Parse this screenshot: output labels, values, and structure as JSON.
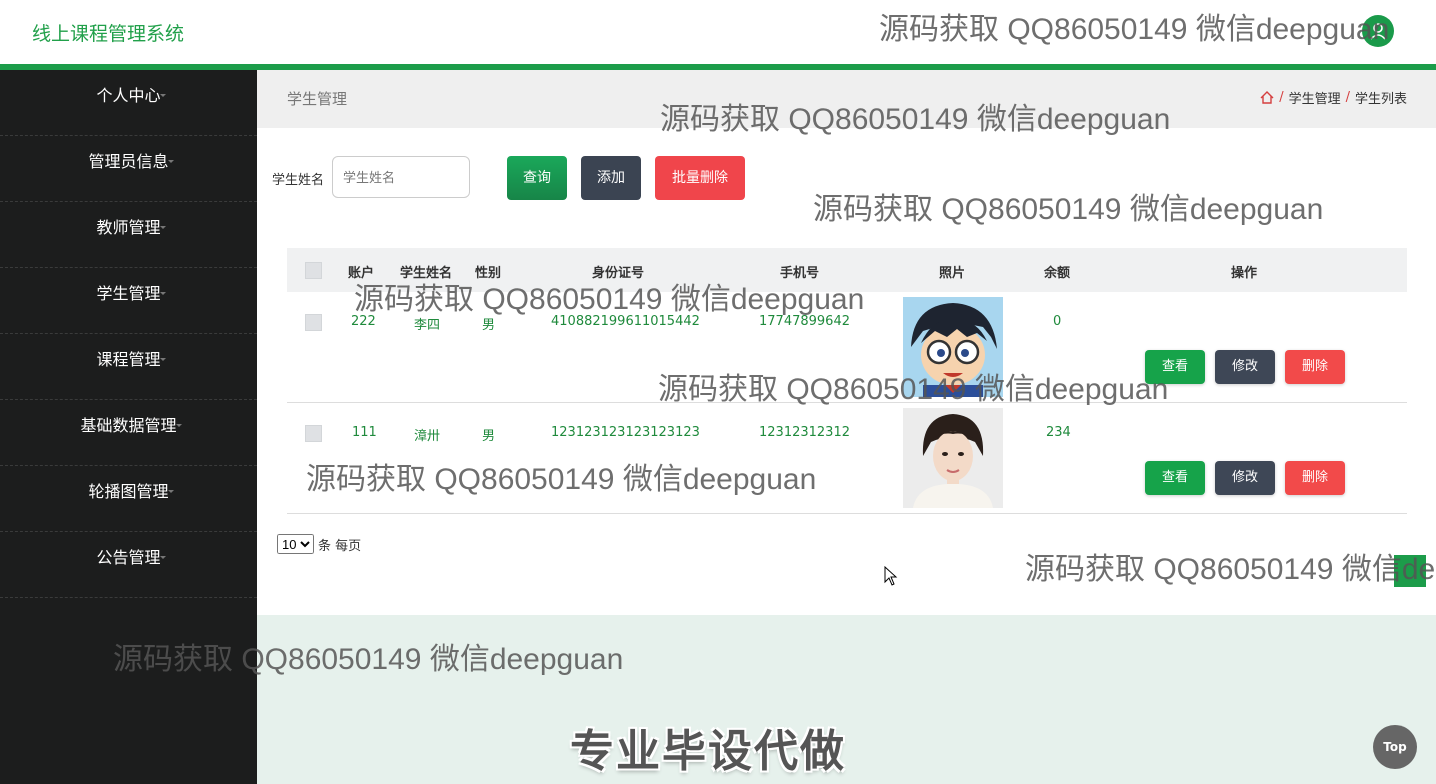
{
  "app": {
    "title": "线上课程管理系统"
  },
  "sidebar": {
    "items": [
      {
        "label": "个人中心"
      },
      {
        "label": "管理员信息"
      },
      {
        "label": "教师管理"
      },
      {
        "label": "学生管理"
      },
      {
        "label": "课程管理"
      },
      {
        "label": "基础数据管理"
      },
      {
        "label": "轮播图管理"
      },
      {
        "label": "公告管理"
      }
    ]
  },
  "page": {
    "title": "学生管理",
    "breadcrumb": [
      "学生管理",
      "学生列表"
    ]
  },
  "search": {
    "label": "学生姓名",
    "placeholder": "学生姓名",
    "query_btn": "查询",
    "add_btn": "添加",
    "batch_delete_btn": "批量删除"
  },
  "table": {
    "headers": [
      "账户",
      "学生姓名",
      "性别",
      "身份证号",
      "手机号",
      "照片",
      "余额",
      "操作"
    ],
    "rows": [
      {
        "account": "222",
        "name": "李四",
        "gender": "男",
        "id_number": "410882199611015442",
        "phone": "17747899642",
        "photo": "cartoon-boy-glasses",
        "balance": "0"
      },
      {
        "account": "111",
        "name": "漳卅",
        "gender": "男",
        "id_number": "123123123123123123",
        "phone": "12312312312",
        "photo": "woman-portrait",
        "balance": "234"
      }
    ],
    "actions": {
      "view": "查看",
      "edit": "修改",
      "delete": "删除"
    }
  },
  "pagination": {
    "page_size": "10",
    "suffix": "条 每页"
  },
  "footer": {
    "slogan": "专业毕设代做",
    "top_btn": "Top"
  },
  "watermark": "源码获取 QQ86050149 微信deepguan",
  "colors": {
    "brand": "#1c9c4a",
    "danger": "#f24a4a",
    "dark": "#3b4452",
    "sidebar": "#1c1d1d"
  }
}
